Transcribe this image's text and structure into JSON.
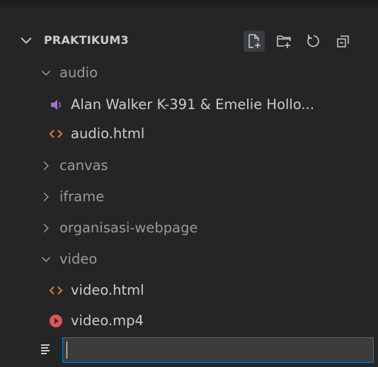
{
  "explorer": {
    "folder_name": "PRAKTIKUM3",
    "actions": [
      {
        "name": "new-file",
        "icon": "new-file-icon"
      },
      {
        "name": "new-folder",
        "icon": "new-folder-icon"
      },
      {
        "name": "refresh",
        "icon": "refresh-icon"
      },
      {
        "name": "collapse-all",
        "icon": "collapse-all-icon"
      }
    ]
  },
  "tree": {
    "audio_folder": "audio",
    "audio_file": "Alan Walker K-391 & Emelie Hollo...",
    "audio_html": "audio.html",
    "canvas_folder": "canvas",
    "iframe_folder": "iframe",
    "organisasi_folder": "organisasi-webpage",
    "video_folder": "video",
    "video_html": "video.html",
    "video_mp4": "video.mp4"
  },
  "new_file_input": {
    "value": ""
  },
  "colors": {
    "background": "#252526",
    "text": "#cccccc",
    "html_icon": "#e37933",
    "audio_icon": "#a074c4",
    "video_icon": "#e0555a",
    "focus_border": "#007fd4"
  }
}
